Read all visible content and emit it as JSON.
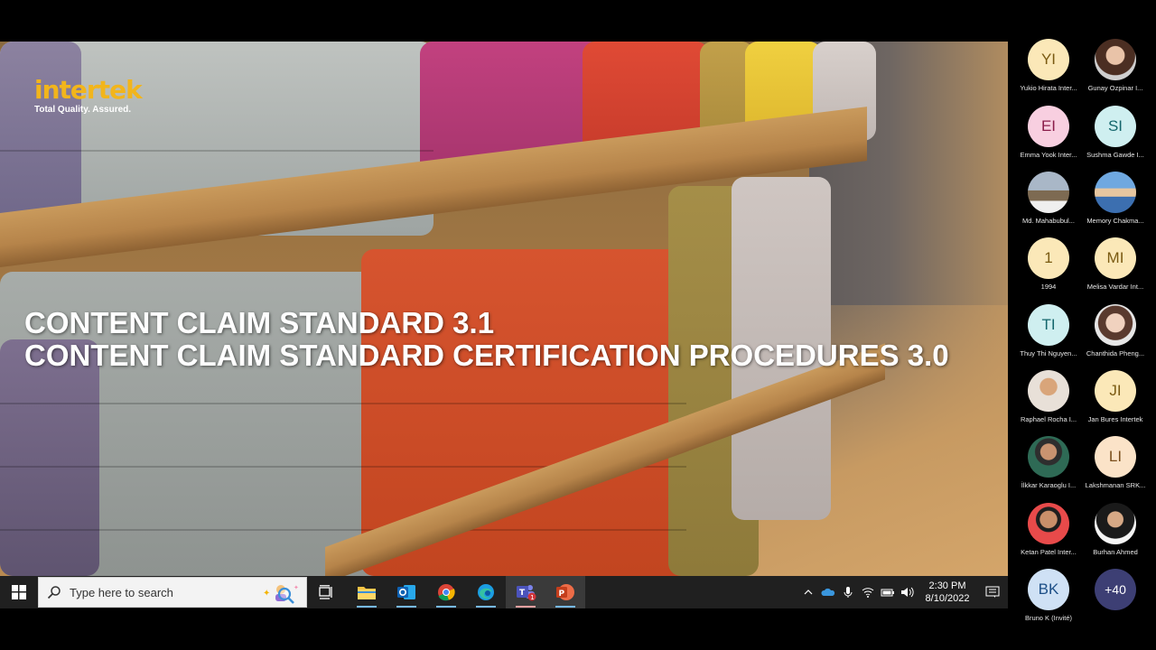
{
  "slide": {
    "logo_word": "intertek",
    "logo_tagline": "Total Quality. Assured.",
    "title_line1": "CONTENT CLAIM STANDARD 3.1",
    "title_line2": "CONTENT CLAIM STANDARD CERTIFICATION PROCEDURES 3.0"
  },
  "taskbar": {
    "search_placeholder": "Type here to search",
    "apps": [
      "task-view",
      "file-explorer",
      "outlook",
      "chrome",
      "edge",
      "teams",
      "powerpoint"
    ],
    "teams_badge": "1",
    "time": "2:30 PM",
    "date": "8/10/2022"
  },
  "participants": [
    {
      "initials": "YI",
      "name": "Yukio Hirata  Inter...",
      "style": "av-yellow"
    },
    {
      "initials": "",
      "name": "Gunay Ozpinar  I...",
      "style": "photo"
    },
    {
      "initials": "EI",
      "name": "Emma Yook  Inter...",
      "style": "av-pink"
    },
    {
      "initials": "SI",
      "name": "Sushma Gawde  I...",
      "style": "av-teal"
    },
    {
      "initials": "",
      "name": "Md. Mahabubul...",
      "style": "photo"
    },
    {
      "initials": "",
      "name": "Memory Chakma...",
      "style": "photo"
    },
    {
      "initials": "1",
      "name": "1994",
      "style": "av-yellow"
    },
    {
      "initials": "MI",
      "name": "Melisa Vardar  Int...",
      "style": "av-yellow"
    },
    {
      "initials": "TI",
      "name": "Thuy Thi Nguyen...",
      "style": "av-teal"
    },
    {
      "initials": "",
      "name": "Chanthida Pheng...",
      "style": "photo"
    },
    {
      "initials": "",
      "name": "Raphael Rocha  I...",
      "style": "photo"
    },
    {
      "initials": "JI",
      "name": "Jan Bures  Intertek",
      "style": "av-yellow"
    },
    {
      "initials": "",
      "name": "İlkkar Karaoglu  I...",
      "style": "photo"
    },
    {
      "initials": "LI",
      "name": "Lakshmanan SRK...",
      "style": "av-peach"
    },
    {
      "initials": "",
      "name": "Ketan Patel  Inter...",
      "style": "photo"
    },
    {
      "initials": "",
      "name": "Burhan Ahmed",
      "style": "photo"
    },
    {
      "initials": "BK",
      "name": "Bruno K (Invité)",
      "style": "av-blue"
    },
    {
      "initials": "+40",
      "name": "",
      "style": "av-more"
    }
  ],
  "colors": {
    "brand_yellow": "#f2b51b",
    "taskbar": "#202020",
    "more_badge": "#3d3f74"
  }
}
